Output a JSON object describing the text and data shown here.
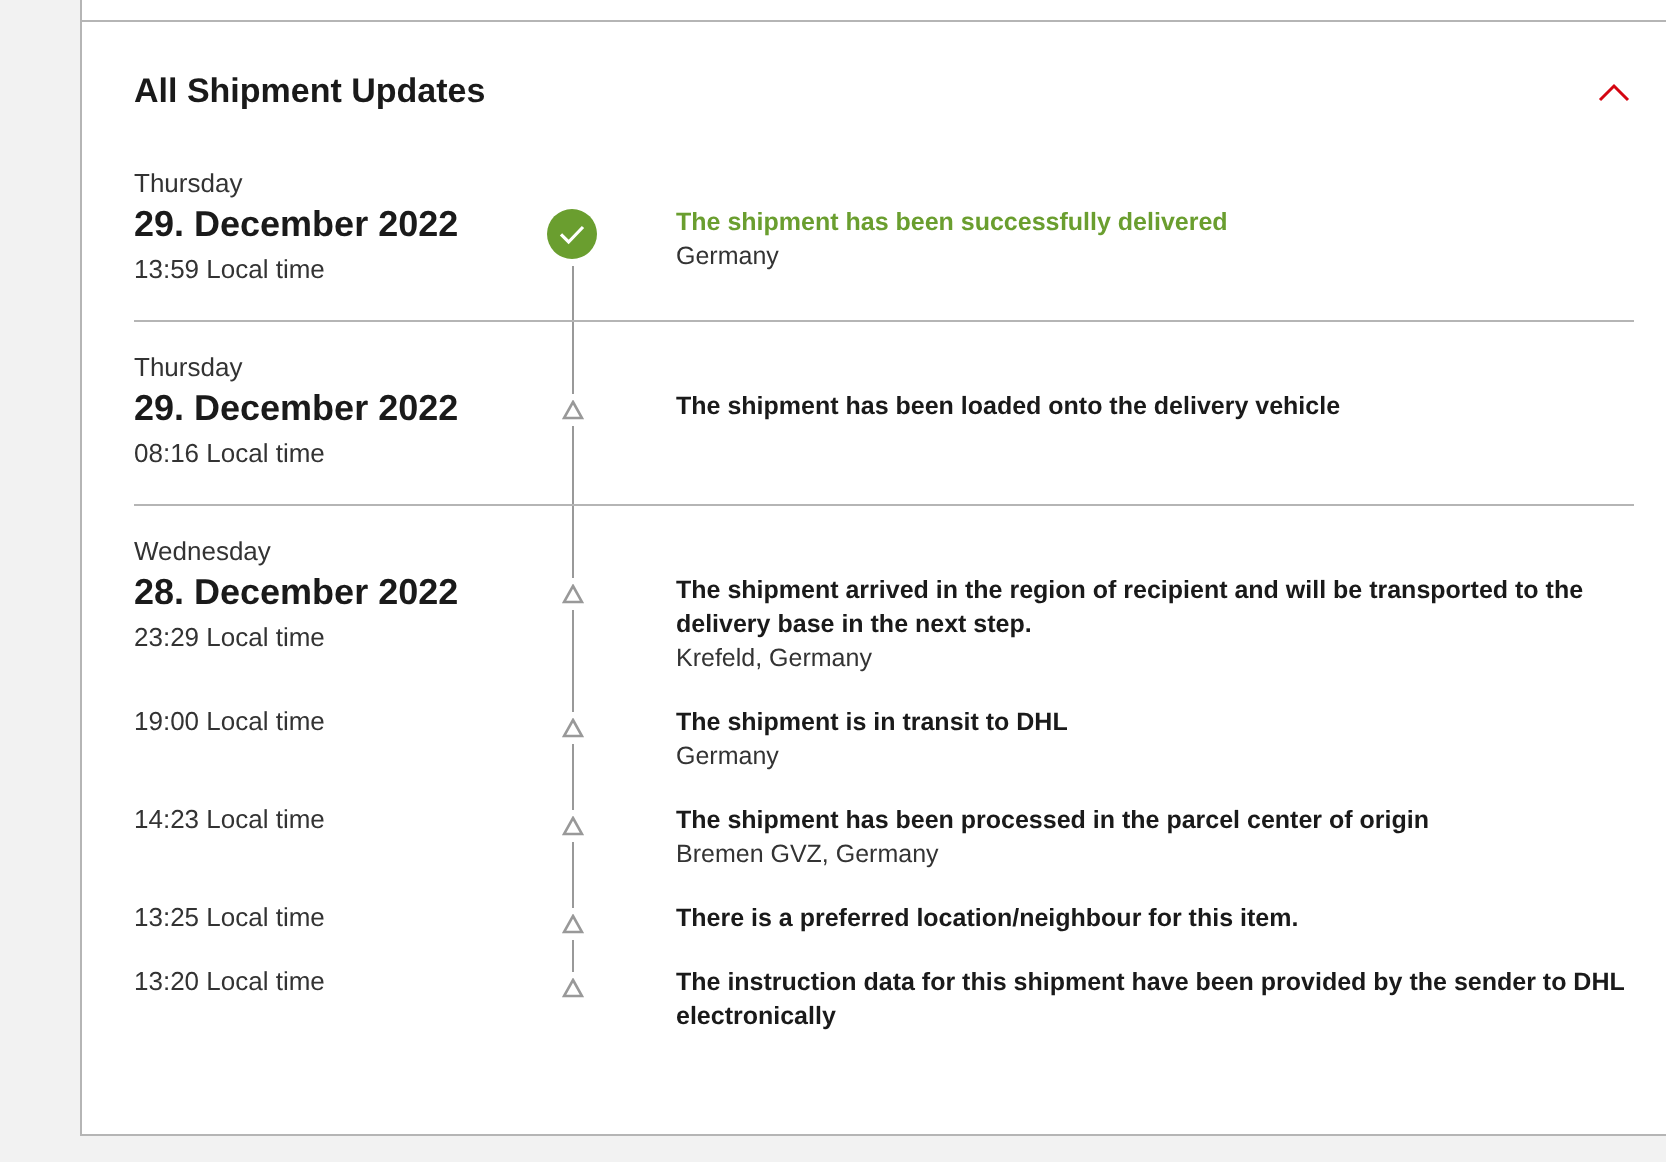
{
  "section": {
    "title": "All Shipment Updates",
    "expanded": true
  },
  "groups": [
    {
      "weekday": "Thursday",
      "date": "29. December 2022",
      "events": [
        {
          "time": "13:59 Local time",
          "kind": "delivered",
          "title": "The shipment has been successfully delivered",
          "location": "Germany"
        }
      ]
    },
    {
      "weekday": "Thursday",
      "date": "29. December 2022",
      "events": [
        {
          "time": "08:16 Local time",
          "kind": "step",
          "title": "The shipment has been loaded onto the delivery vehicle"
        }
      ]
    },
    {
      "weekday": "Wednesday",
      "date": "28. December 2022",
      "events": [
        {
          "time": "23:29 Local time",
          "kind": "step",
          "title": "The shipment arrived in the region of recipient and will be transported to the delivery base in the next step.",
          "location": "Krefeld, Germany"
        },
        {
          "time": "19:00 Local time",
          "kind": "step",
          "title": "The shipment is in transit to DHL",
          "location": "Germany"
        },
        {
          "time": "14:23 Local time",
          "kind": "step",
          "title": "The shipment has been processed in the parcel center of origin",
          "location": "Bremen GVZ, Germany"
        },
        {
          "time": "13:25 Local time",
          "kind": "step",
          "title": "There is a preferred location/neighbour for this item."
        },
        {
          "time": "13:20 Local time",
          "kind": "step",
          "title": "The instruction data for this shipment have been provided by the sender to DHL electronically"
        }
      ]
    }
  ]
}
